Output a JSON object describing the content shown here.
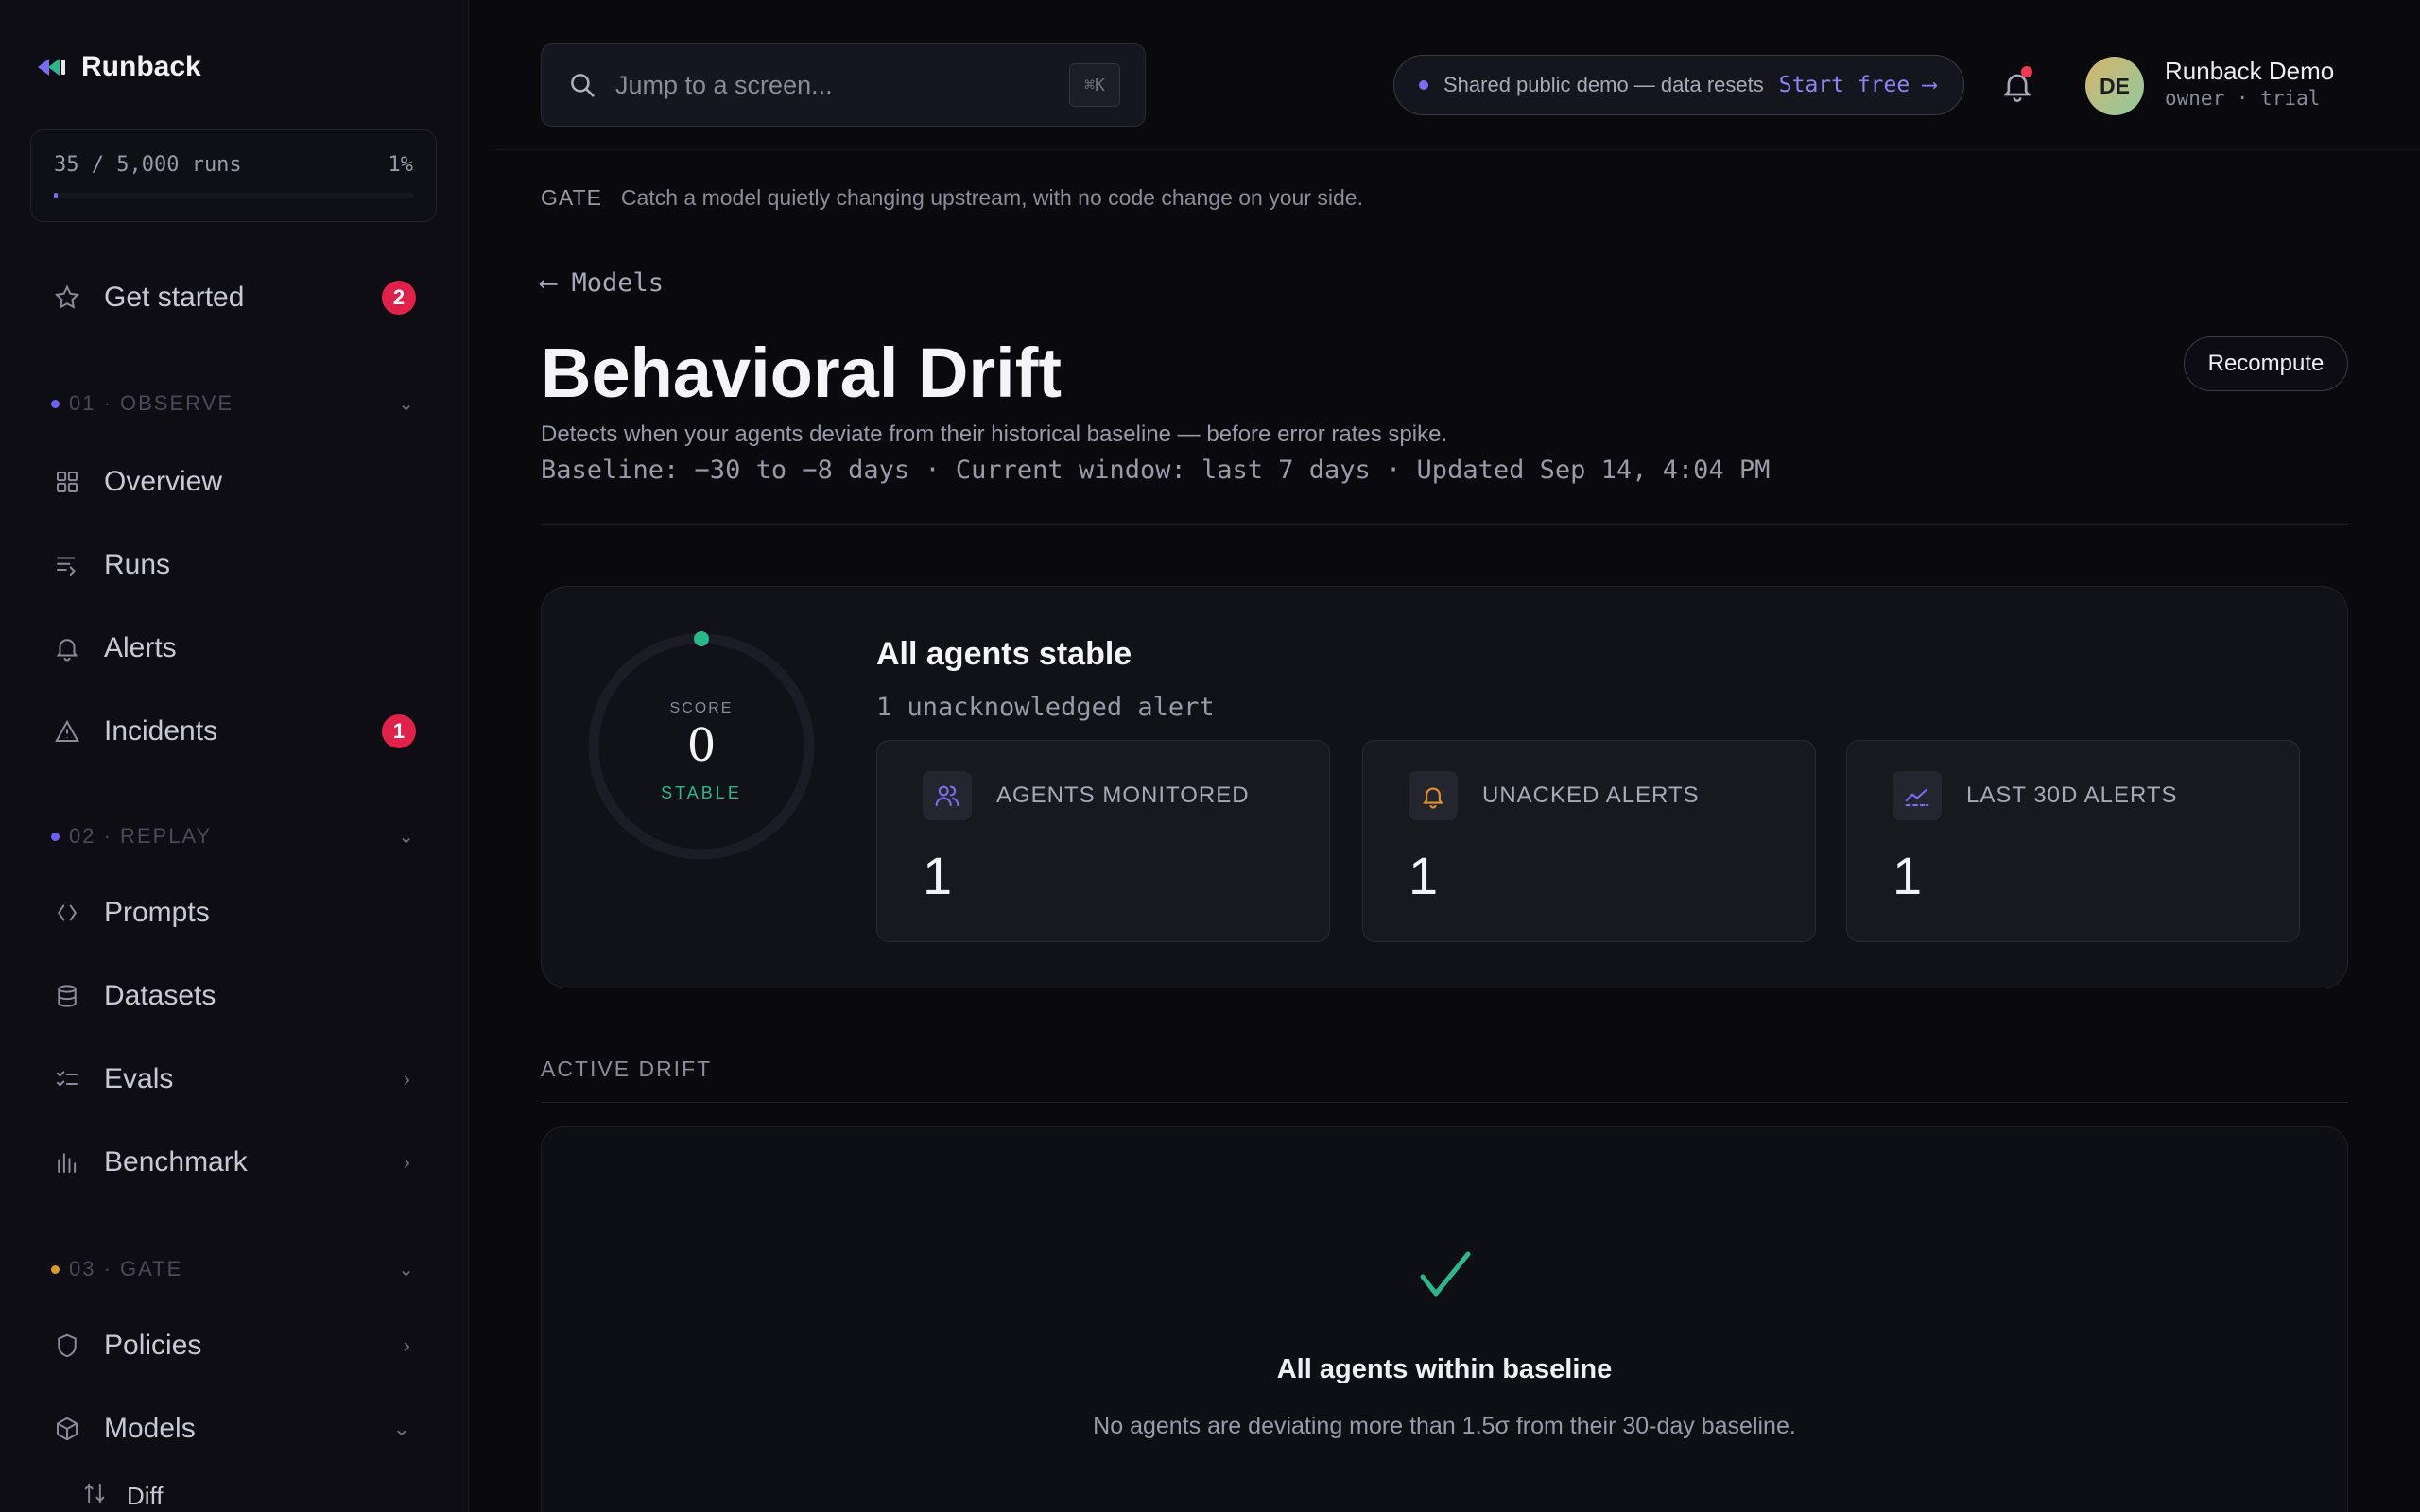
{
  "app": {
    "name": "Runback"
  },
  "usage": {
    "text": "35 / 5,000 runs",
    "percent_label": "1%",
    "fraction": 0.007
  },
  "sidebar": {
    "get_started": {
      "label": "Get started",
      "badge": "2"
    },
    "sections": [
      {
        "label": "01 · OBSERVE",
        "dot_color": "#6d5ff0"
      },
      {
        "label": "02 · REPLAY",
        "dot_color": "#6d5ff0"
      },
      {
        "label": "03 · GATE",
        "dot_color": "#d99a2b"
      }
    ],
    "observe": [
      {
        "label": "Overview",
        "icon": "grid-icon"
      },
      {
        "label": "Runs",
        "icon": "list-arrow-icon"
      },
      {
        "label": "Alerts",
        "icon": "bell-icon"
      },
      {
        "label": "Incidents",
        "icon": "warning-icon",
        "badge": "1"
      }
    ],
    "replay": [
      {
        "label": "Prompts",
        "icon": "code-icon"
      },
      {
        "label": "Datasets",
        "icon": "database-icon"
      },
      {
        "label": "Evals",
        "icon": "checklist-icon"
      },
      {
        "label": "Benchmark",
        "icon": "bars-icon"
      }
    ],
    "gate": [
      {
        "label": "Policies",
        "icon": "shield-icon"
      },
      {
        "label": "Models",
        "icon": "cube-icon"
      }
    ],
    "models_sub": [
      {
        "label": "Diff",
        "icon": "diff-icon"
      }
    ]
  },
  "topbar": {
    "search_placeholder": "Jump to a screen...",
    "shortcut": "⌘K",
    "demo_text": "Shared public demo — data resets",
    "demo_link": "Start free ⟶",
    "user_initials": "DE",
    "user_name": "Runback Demo",
    "user_role": "owner · trial"
  },
  "page": {
    "gate_tag": "GATE",
    "gate_text": "Catch a model quietly changing upstream, with no code change on your side.",
    "back": "⟵ Models",
    "title": "Behavioral Drift",
    "description": "Detects when your agents deviate from their historical baseline — before error rates spike.",
    "meta": "Baseline: −30 to −8 days · Current window: last 7 days · Updated Sep 14, 4:04 PM",
    "recompute": "Recompute"
  },
  "score": {
    "label": "SCORE",
    "value": "0",
    "status": "STABLE",
    "headline": "All agents stable",
    "subline": "1 unacknowledged alert"
  },
  "stats": [
    {
      "label": "AGENTS MONITORED",
      "value": "1",
      "icon": "users-icon",
      "color": "#7c6cf0"
    },
    {
      "label": "UNACKED ALERTS",
      "value": "1",
      "icon": "bell-icon",
      "color": "#e0962b"
    },
    {
      "label": "LAST 30D ALERTS",
      "value": "1",
      "icon": "trend-icon",
      "color": "#7c6cf0"
    }
  ],
  "active_drift": {
    "title": "ACTIVE DRIFT",
    "empty_title": "All agents within baseline",
    "empty_sub": "No agents are deviating more than 1.5σ from their 30-day baseline."
  },
  "colors": {
    "accent": "#7c6cf0",
    "danger": "#e0224a",
    "success": "#2bb78a",
    "warning": "#e0962b"
  }
}
